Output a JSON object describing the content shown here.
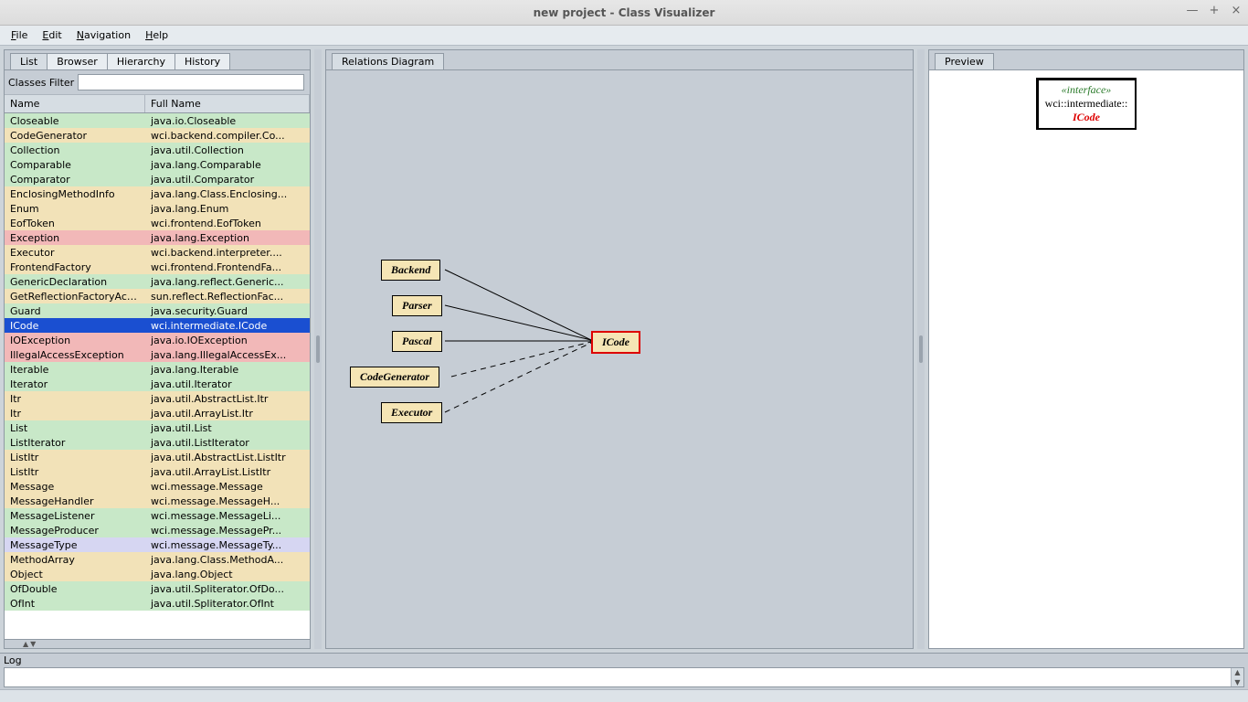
{
  "window": {
    "title": "new project - Class Visualizer",
    "btn_min": "—",
    "btn_max": "+",
    "btn_close": "×"
  },
  "menu": {
    "file": "File",
    "edit": "Edit",
    "nav": "Navigation",
    "help": "Help"
  },
  "left": {
    "tabs": {
      "list": "List",
      "browser": "Browser",
      "hierarchy": "Hierarchy",
      "history": "History"
    },
    "filter_label": "Classes Filter",
    "filter_value": "",
    "head_name": "Name",
    "head_full": "Full Name",
    "rows": [
      {
        "n": "Closeable",
        "f": "java.io.Closeable",
        "c": "c-green"
      },
      {
        "n": "CodeGenerator",
        "f": "wci.backend.compiler.Co...",
        "c": "c-tan"
      },
      {
        "n": "Collection",
        "f": "java.util.Collection",
        "c": "c-green"
      },
      {
        "n": "Comparable",
        "f": "java.lang.Comparable",
        "c": "c-green"
      },
      {
        "n": "Comparator",
        "f": "java.util.Comparator",
        "c": "c-green"
      },
      {
        "n": "EnclosingMethodInfo",
        "f": "java.lang.Class.Enclosing...",
        "c": "c-tan"
      },
      {
        "n": "Enum",
        "f": "java.lang.Enum",
        "c": "c-tan"
      },
      {
        "n": "EofToken",
        "f": "wci.frontend.EofToken",
        "c": "c-tan"
      },
      {
        "n": "Exception",
        "f": "java.lang.Exception",
        "c": "c-pink"
      },
      {
        "n": "Executor",
        "f": "wci.backend.interpreter....",
        "c": "c-tan"
      },
      {
        "n": "FrontendFactory",
        "f": "wci.frontend.FrontendFa...",
        "c": "c-tan"
      },
      {
        "n": "GenericDeclaration",
        "f": "java.lang.reflect.Generic...",
        "c": "c-green"
      },
      {
        "n": "GetReflectionFactoryAction",
        "f": "sun.reflect.ReflectionFac...",
        "c": "c-tan"
      },
      {
        "n": "Guard",
        "f": "java.security.Guard",
        "c": "c-green"
      },
      {
        "n": "ICode",
        "f": "wci.intermediate.ICode",
        "c": "c-sel"
      },
      {
        "n": "IOException",
        "f": "java.io.IOException",
        "c": "c-pink"
      },
      {
        "n": "IllegalAccessException",
        "f": "java.lang.IllegalAccessEx...",
        "c": "c-pink"
      },
      {
        "n": "Iterable",
        "f": "java.lang.Iterable",
        "c": "c-green"
      },
      {
        "n": "Iterator",
        "f": "java.util.Iterator",
        "c": "c-green"
      },
      {
        "n": "Itr",
        "f": "java.util.AbstractList.Itr",
        "c": "c-tan"
      },
      {
        "n": "Itr",
        "f": "java.util.ArrayList.Itr",
        "c": "c-tan"
      },
      {
        "n": "List",
        "f": "java.util.List",
        "c": "c-green"
      },
      {
        "n": "ListIterator",
        "f": "java.util.ListIterator",
        "c": "c-green"
      },
      {
        "n": "ListItr",
        "f": "java.util.AbstractList.ListItr",
        "c": "c-tan"
      },
      {
        "n": "ListItr",
        "f": "java.util.ArrayList.ListItr",
        "c": "c-tan"
      },
      {
        "n": "Message",
        "f": "wci.message.Message",
        "c": "c-tan"
      },
      {
        "n": "MessageHandler",
        "f": "wci.message.MessageH...",
        "c": "c-tan"
      },
      {
        "n": "MessageListener",
        "f": "wci.message.MessageLi...",
        "c": "c-green"
      },
      {
        "n": "MessageProducer",
        "f": "wci.message.MessagePr...",
        "c": "c-green"
      },
      {
        "n": "MessageType",
        "f": "wci.message.MessageTy...",
        "c": "c-lilac"
      },
      {
        "n": "MethodArray",
        "f": "java.lang.Class.MethodA...",
        "c": "c-tan"
      },
      {
        "n": "Object",
        "f": "java.lang.Object",
        "c": "c-tan"
      },
      {
        "n": "OfDouble",
        "f": "java.util.Spliterator.OfDo...",
        "c": "c-green"
      },
      {
        "n": "OfInt",
        "f": "java.util.Spliterator.OfInt",
        "c": "c-green"
      }
    ]
  },
  "center": {
    "tab": "Relations Diagram"
  },
  "diagram": {
    "nodes": {
      "backend": "Backend",
      "parser": "Parser",
      "pascal": "Pascal",
      "codegen": "CodeGenerator",
      "executor": "Executor",
      "icode": "ICode"
    }
  },
  "right": {
    "tab": "Preview"
  },
  "preview": {
    "stereo": "«interface»",
    "ns": "wci::intermediate::",
    "name": "ICode"
  },
  "log": {
    "label": "Log"
  }
}
